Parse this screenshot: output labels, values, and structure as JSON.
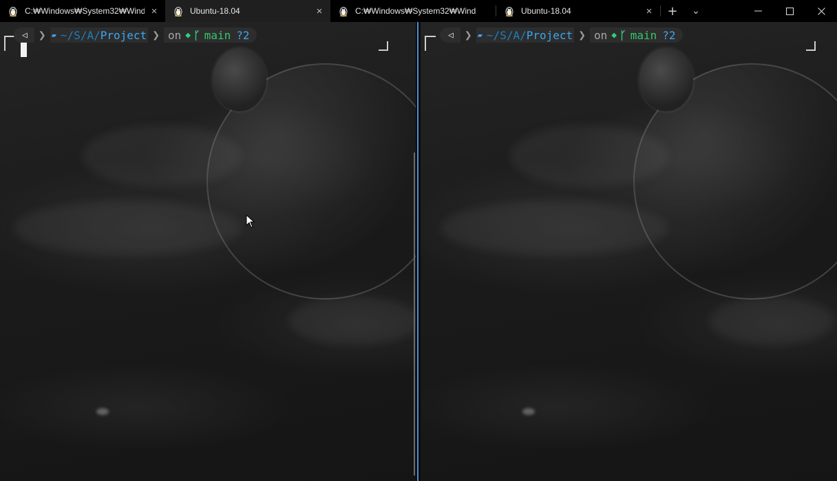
{
  "window": {
    "tabs": [
      {
        "title": "C:₩Windows₩System32₩Wind",
        "icon": "linux-penguin-icon",
        "active": false
      },
      {
        "title": "Ubuntu-18.04",
        "icon": "linux-penguin-icon",
        "active": true
      },
      {
        "title": "C:₩Windows₩System32₩Wind",
        "icon": "linux-penguin-icon",
        "active": false
      },
      {
        "title": "Ubuntu-18.04",
        "icon": "linux-penguin-icon",
        "active": false
      }
    ],
    "new_tab_glyph": "+",
    "dropdown_glyph": "⌄",
    "close_glyph": "×",
    "minimize_glyph": "—",
    "maximize_glyph": "☐",
    "window_close_glyph": "✕"
  },
  "panes": {
    "left": {
      "prompt": {
        "path_home": "~",
        "sep1": "/",
        "path_s": "S",
        "sep2": "/",
        "path_a": "A",
        "sep3": "/",
        "path_project": "Project",
        "on_text": "on",
        "branch": "main",
        "git_status": "?2"
      }
    },
    "right": {
      "prompt": {
        "path_home": "~",
        "sep1": "/",
        "path_s": "S",
        "sep2": "/",
        "path_a": "A",
        "sep3": "/",
        "path_project": "Project",
        "on_text": "on",
        "branch": "main",
        "git_status": "?2"
      }
    }
  },
  "colors": {
    "accent_divider": "#4a8fd6",
    "path": "#3aa8f0",
    "branch": "#32c86e"
  }
}
